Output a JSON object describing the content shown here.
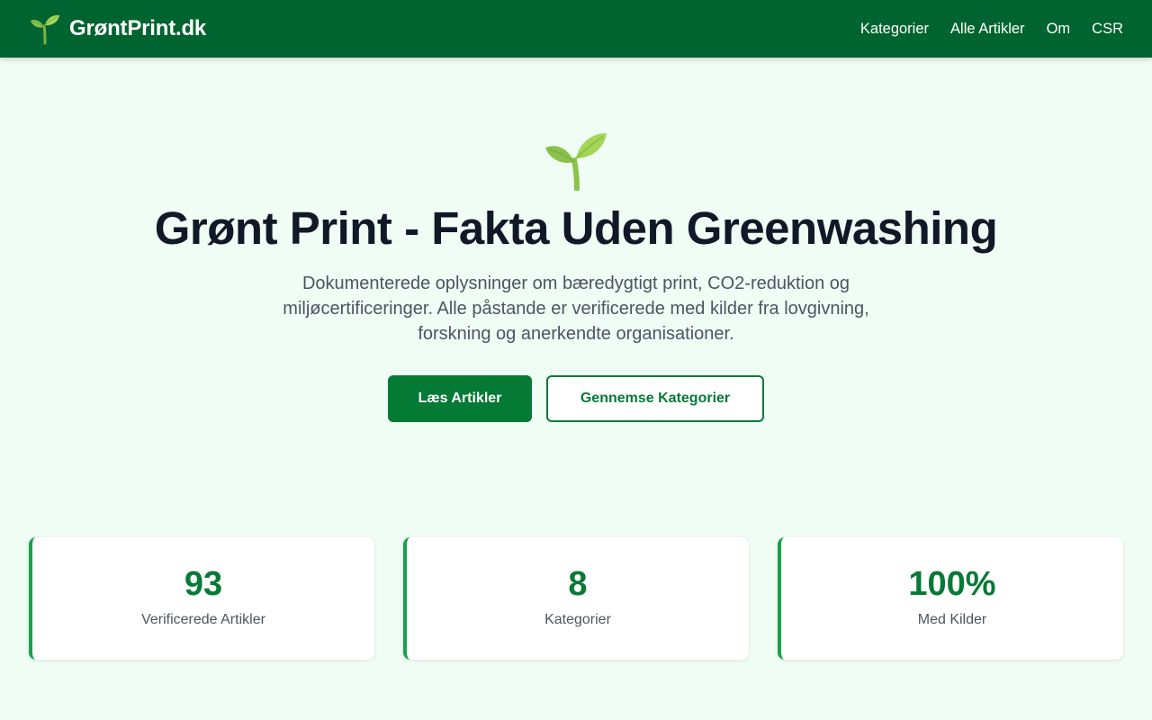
{
  "header": {
    "brand_icon": "seedling-icon",
    "brand_name": "GrøntPrint.dk",
    "nav": [
      {
        "label": "Kategorier"
      },
      {
        "label": "Alle Artikler"
      },
      {
        "label": "Om"
      },
      {
        "label": "CSR"
      }
    ]
  },
  "hero": {
    "icon": "seedling-icon",
    "title": "Grønt Print - Fakta Uden Greenwashing",
    "subtitle": "Dokumenterede oplysninger om bæredygtigt print, CO2-reduktion og miljøcertificeringer. Alle påstande er verificerede med kilder fra lovgivning, forskning og anerkendte organisationer.",
    "primary_button": "Læs Artikler",
    "secondary_button": "Gennemse Kategorier"
  },
  "stats": [
    {
      "value": "93",
      "label": "Verificerede Artikler"
    },
    {
      "value": "8",
      "label": "Kategorier"
    },
    {
      "value": "100%",
      "label": "Med Kilder"
    }
  ],
  "colors": {
    "header_bg": "#006430",
    "page_bg": "#f0fdf4",
    "accent": "#057a35",
    "stat_border": "#16a34a",
    "title_text": "#111827",
    "body_text": "#4b5563"
  }
}
